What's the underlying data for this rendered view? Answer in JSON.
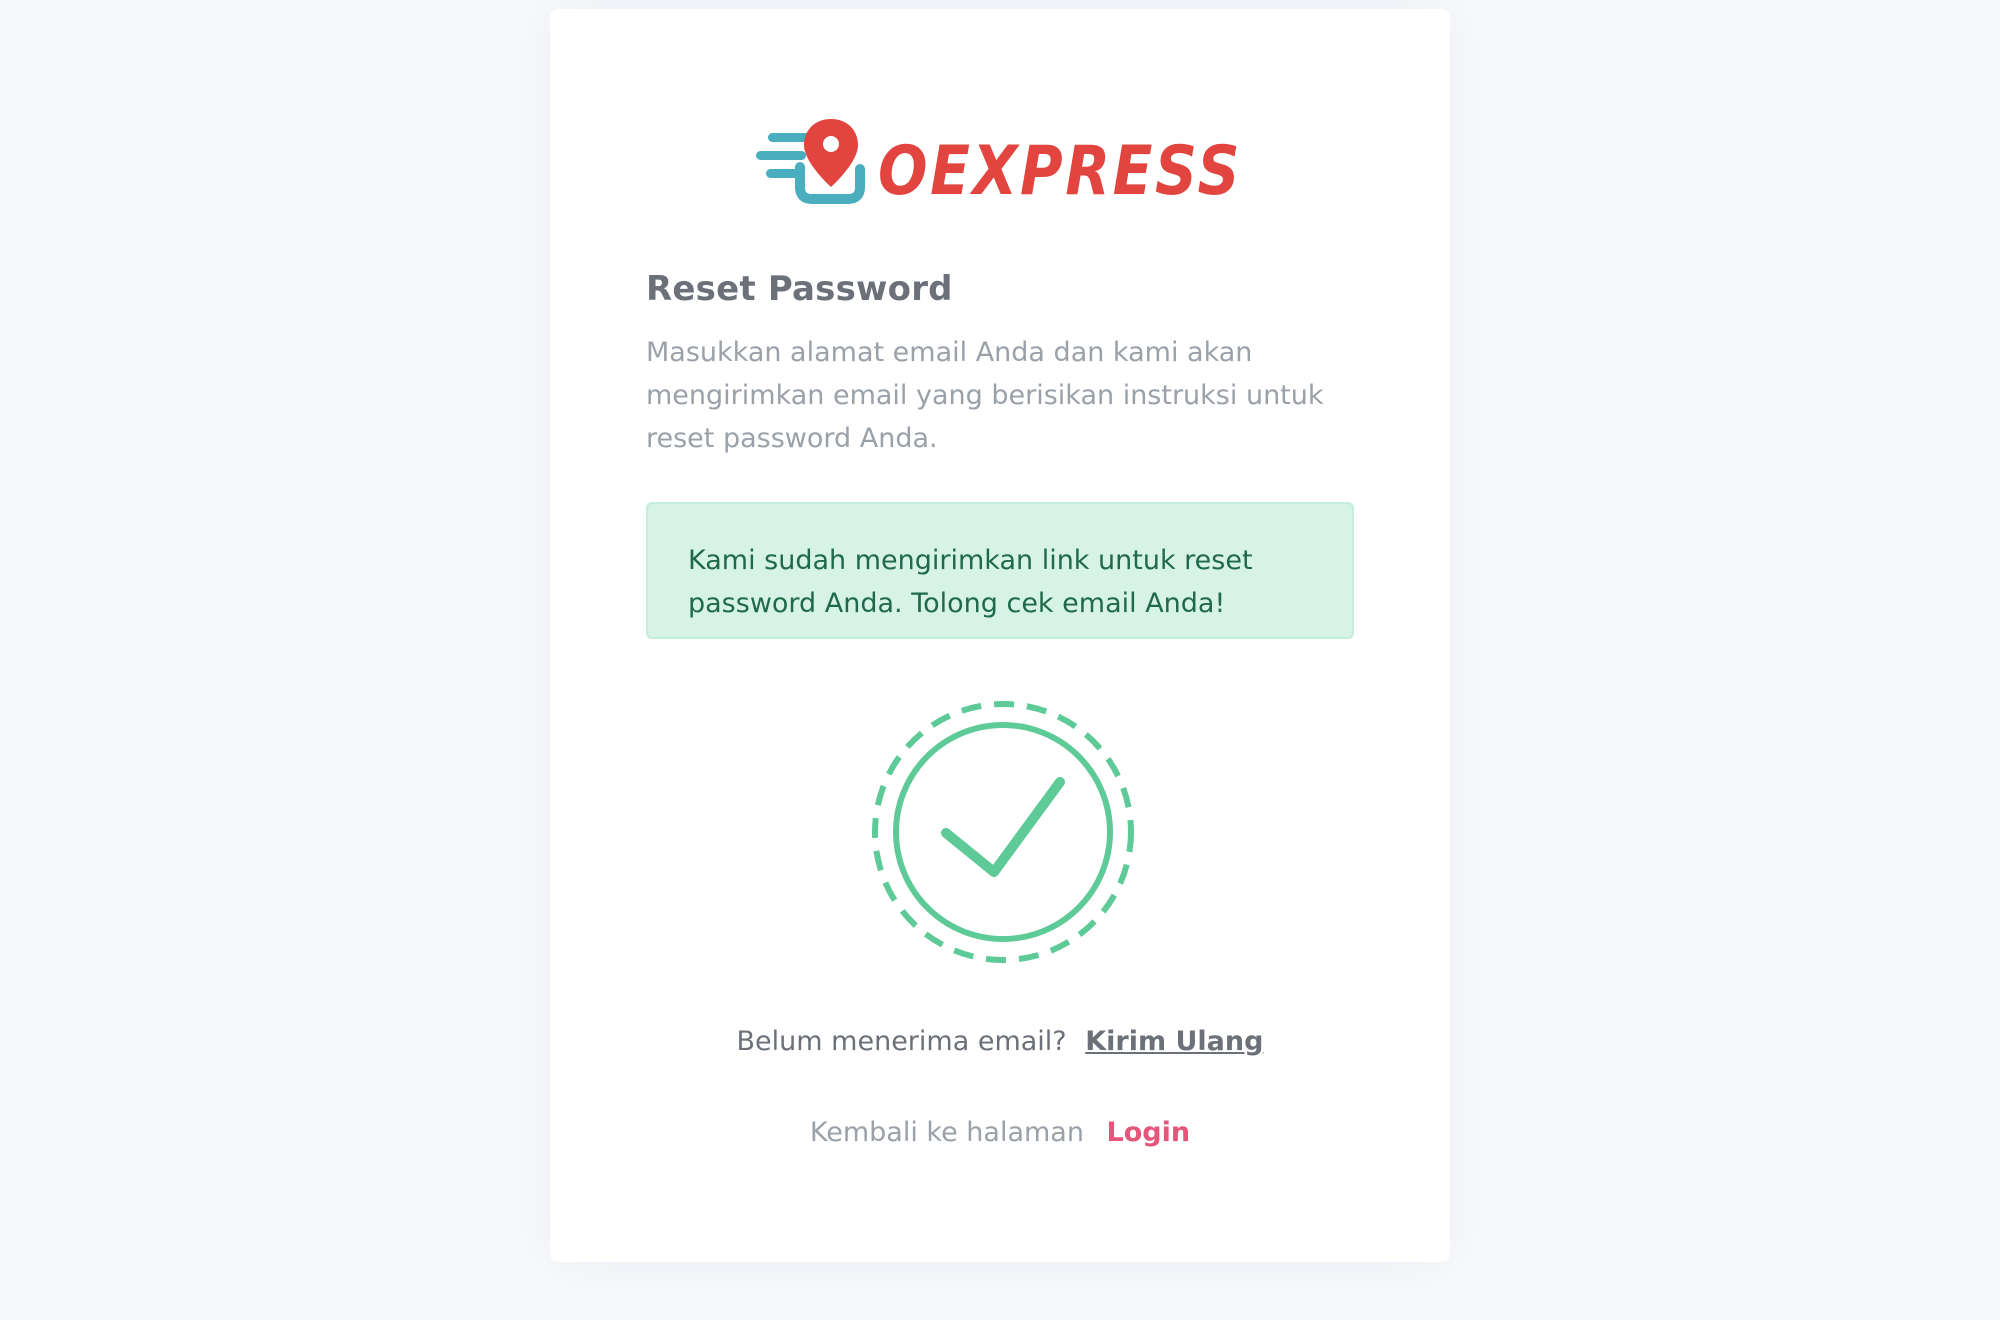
{
  "brand": {
    "name": "OEXPRESS",
    "color_primary": "#e2453f",
    "color_secondary": "#4aaebf"
  },
  "page": {
    "title": "Reset Password",
    "description": "Masukkan alamat email Anda dan kami akan mengirimkan email yang berisikan instruksi untuk reset password Anda."
  },
  "alert": {
    "message": "Kami sudah mengirimkan link untuk reset password Anda. Tolong cek email Anda!",
    "background": "#d7f3e8",
    "text_color": "#1f6a49"
  },
  "success_icon": {
    "name": "check-circle-icon",
    "color": "#5dca98"
  },
  "resend": {
    "prompt": "Belum menerima email?",
    "link_label": "Kirim Ulang"
  },
  "back": {
    "prompt": "Kembali ke halaman",
    "link_label": "Login",
    "link_color": "#e6557a"
  }
}
